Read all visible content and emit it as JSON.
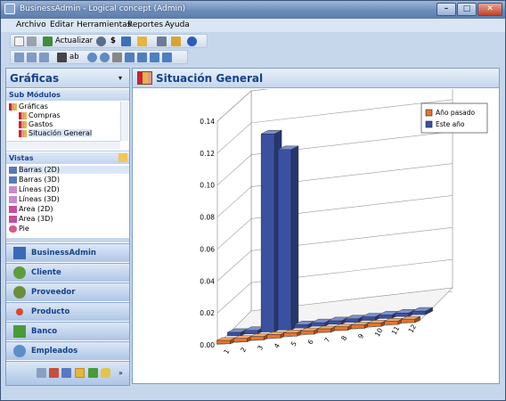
{
  "window": {
    "title": "BusinessAdmin - Logical concept (Admin)"
  },
  "menu": [
    "Archivo",
    "Editar",
    "Herramientas",
    "Reportes",
    "Ayuda"
  ],
  "toolbar": {
    "actualizar": "Actualizar"
  },
  "left": {
    "header": "Gráficas",
    "submodulos_title": "Sub Módulos",
    "tree": [
      "Gráficas",
      "Compras",
      "Gastos",
      "Situación General"
    ],
    "vistas_title": "Vistas",
    "vistas": [
      "Barras (2D)",
      "Barras (3D)",
      "Líneas (2D)",
      "Líneas (3D)",
      "Area (2D)",
      "Area (3D)",
      "Pie"
    ],
    "nav": [
      "BusinessAdmin",
      "Cliente",
      "Proveedor",
      "Producto",
      "Banco",
      "Empleados"
    ]
  },
  "right": {
    "header": "Situación General"
  },
  "chart_data": {
    "type": "bar",
    "title": "Situación General",
    "xlabel": "",
    "ylabel": "",
    "ylim": [
      0,
      0.14
    ],
    "yticks": [
      "0.00",
      "0.02",
      "0.04",
      "0.06",
      "0.08",
      "0.10",
      "0.12",
      "0.14"
    ],
    "categories": [
      "1",
      "2",
      "3",
      "4",
      "5",
      "6",
      "7",
      "8",
      "9",
      "10",
      "11",
      "12"
    ],
    "series": [
      {
        "name": "Año pasado",
        "color": "#e8742a",
        "values": [
          0,
          0,
          0,
          0,
          0,
          0,
          0,
          0,
          0,
          0,
          0,
          0
        ]
      },
      {
        "name": "Este año",
        "color": "#3a50a0",
        "values": [
          0,
          0.001,
          0.124,
          0.113,
          0,
          0,
          0,
          0,
          0,
          0,
          0,
          0
        ]
      }
    ],
    "legend": "top-right",
    "grid": true
  }
}
